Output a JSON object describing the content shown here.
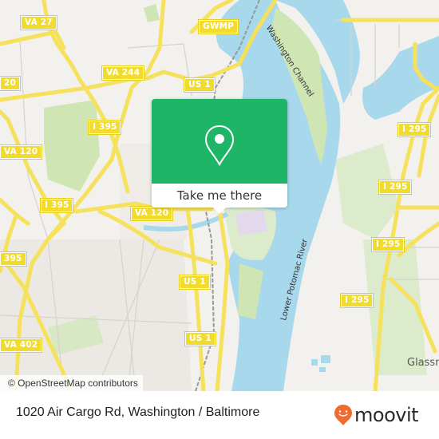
{
  "map": {
    "road_shields": [
      {
        "label": "VA 27"
      },
      {
        "label": "GWMP"
      },
      {
        "label": "VA 244"
      },
      {
        "label": "US 1"
      },
      {
        "label": "I 395"
      },
      {
        "label": "VA 120"
      },
      {
        "label": "I 395"
      },
      {
        "label": "VA 120"
      },
      {
        "label": "I 295"
      },
      {
        "label": "I 295"
      },
      {
        "label": "I 295"
      },
      {
        "label": "I 295"
      },
      {
        "label": "395"
      },
      {
        "label": "US 1"
      },
      {
        "label": "US 1"
      },
      {
        "label": "VA 402"
      },
      {
        "label": "20"
      }
    ],
    "water_labels": {
      "channel": "Washington Channel",
      "river": "Lower Potomac River"
    },
    "place_labels": {
      "glassmanor": "Glassm"
    },
    "attribution": "© OpenStreetMap contributors",
    "colors": {
      "water": "#a8d8ec",
      "land": "#f2f1ed",
      "park": "#cfe5b4",
      "road": "#f6e15c"
    }
  },
  "popup": {
    "icon": "location-pin-icon",
    "button_label": "Take me there",
    "color": "#1eb567"
  },
  "footer": {
    "address": "1020 Air Cargo Rd, Washington / Baltimore",
    "brand": "moovit",
    "brand_color": "#f26a30"
  }
}
